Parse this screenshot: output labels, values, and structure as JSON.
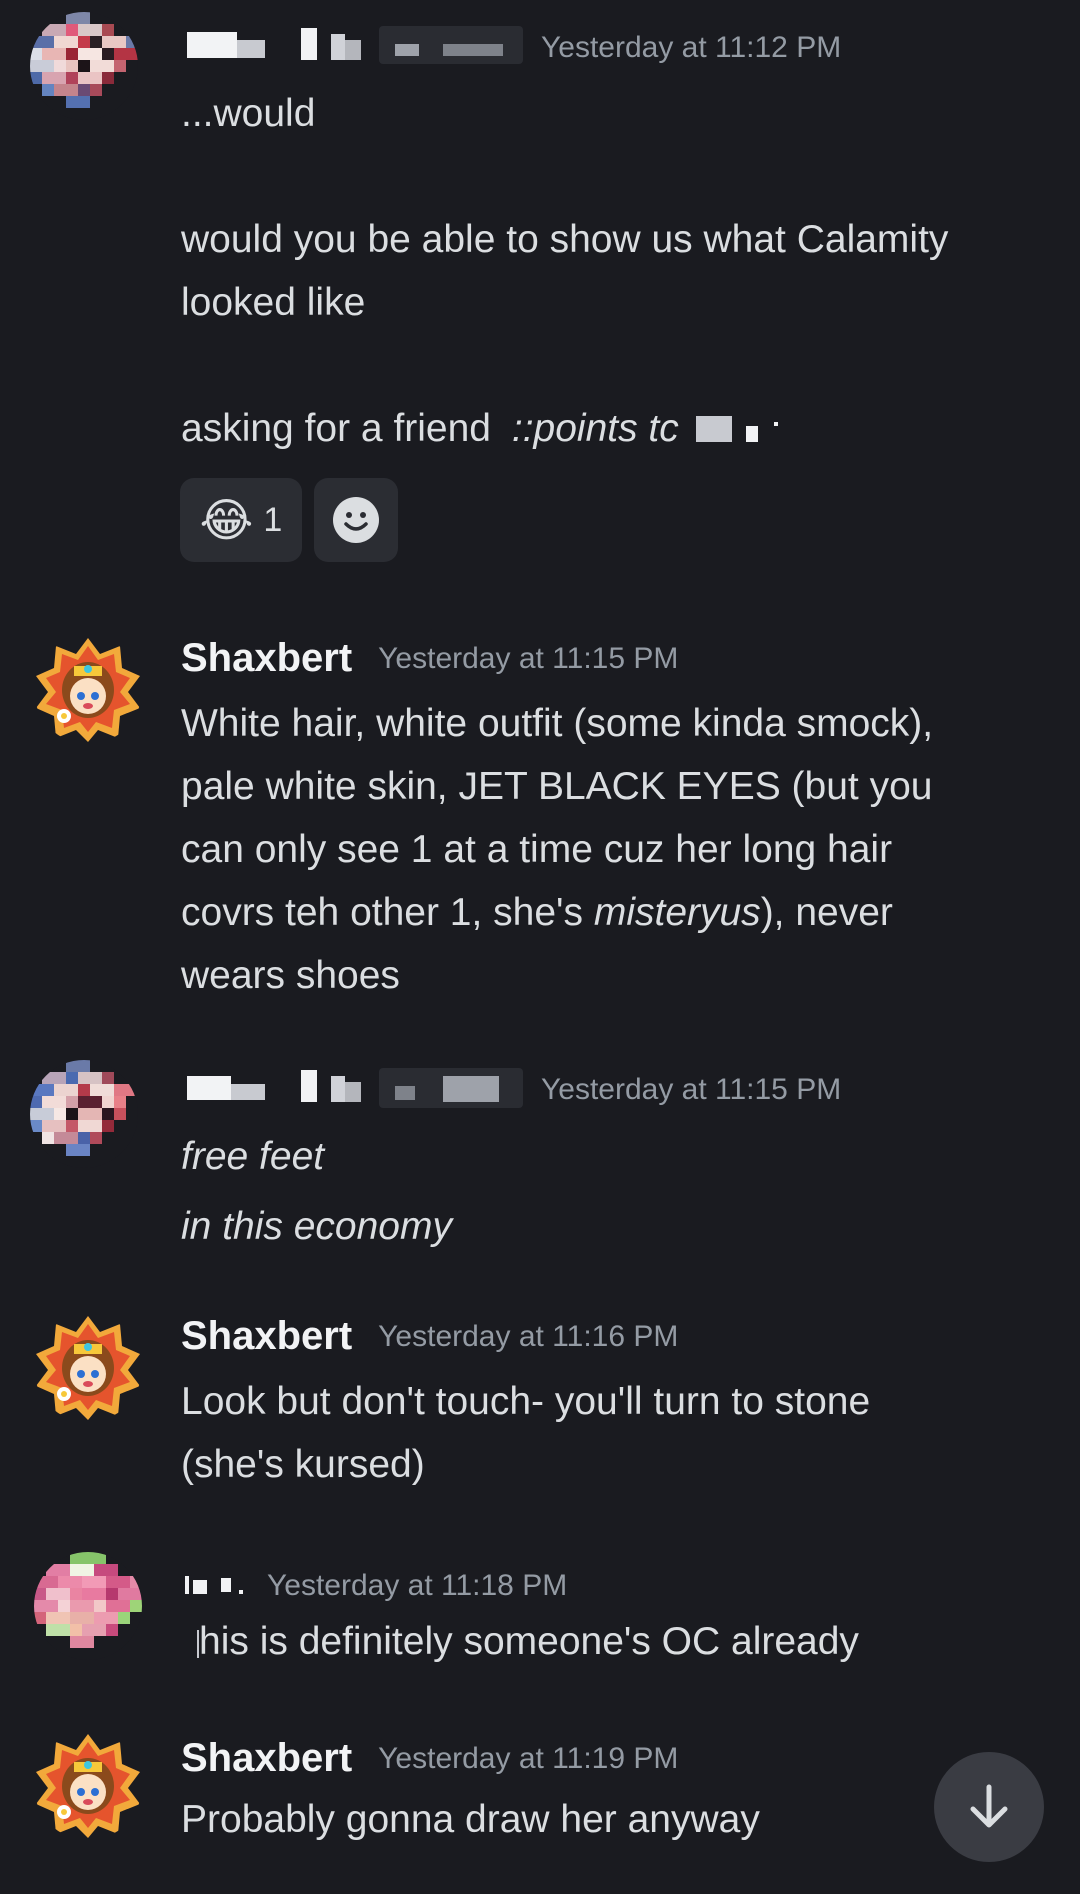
{
  "messages": [
    {
      "username": "",
      "timestamp": "Yesterday at 11:12 PM",
      "lines": [
        "...would",
        "",
        "would you be able to show us what Calamity",
        "looked like",
        "",
        "asking for a friend"
      ],
      "italic_tail": "::points tc",
      "reactions": [
        {
          "emoji": "😂",
          "count": "1"
        }
      ]
    },
    {
      "username": "Shaxbert",
      "timestamp": "Yesterday at 11:15 PM",
      "lines": [
        "White hair, white outfit (some kinda smock),",
        "pale white skin, JET BLACK EYES (but you",
        "can only see 1 at a time cuz her long hair"
      ],
      "line4_before": "covrs teh other 1, she's ",
      "line4_italic": "misteryus",
      "line4_after": "), never",
      "line5": "wears shoes"
    },
    {
      "username": "",
      "timestamp": "Yesterday at 11:15 PM",
      "lines": [
        "free feet",
        "in this economy"
      ]
    },
    {
      "username": "Shaxbert",
      "timestamp": "Yesterday at 11:16 PM",
      "lines": [
        "Look but don't touch- you'll turn to stone",
        "(she's kursed)"
      ]
    },
    {
      "username": "",
      "timestamp": "Yesterday at 11:18 PM",
      "lines": [
        "his is definitely someone's OC already"
      ]
    },
    {
      "username": "Shaxbert",
      "timestamp": "Yesterday at 11:19 PM",
      "lines": [
        "Probably gonna draw her anyway"
      ]
    }
  ],
  "icons": {
    "add_reaction": "smiley-icon",
    "scroll_bottom": "arrow-down-icon"
  },
  "colors": {
    "background": "#1a1b20",
    "text": "#dbdee1",
    "username": "#f2f3f5",
    "timestamp": "#949ba4",
    "reaction_bg": "#2b2d33"
  }
}
